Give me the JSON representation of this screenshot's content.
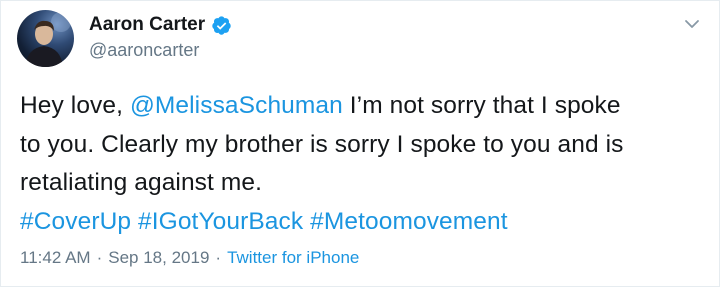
{
  "tweet": {
    "author": {
      "name": "Aaron Carter",
      "handle": "@aaroncarter",
      "verified": true
    },
    "text": {
      "line1_prefix": "Hey love, ",
      "mention": "@MelissaSchuman",
      "line1_suffix": " I’m not sorry that I spoke",
      "line2": "to you. Clearly my brother is sorry I spoke to you and is",
      "line3": "retaliating against me.",
      "hashtags": [
        "#CoverUp",
        "#IGotYourBack",
        "#Metoomovement"
      ]
    },
    "meta": {
      "time": "11:42 AM",
      "separator": "·",
      "date": "Sep 18, 2019",
      "source": "Twitter for iPhone"
    }
  },
  "icons": {
    "verified": "verified-badge-icon",
    "menu": "chevron-down-icon"
  },
  "colors": {
    "link": "#1b95e0",
    "secondary_text": "#657786",
    "primary_text": "#14171a",
    "verified": "#1da1f2"
  }
}
